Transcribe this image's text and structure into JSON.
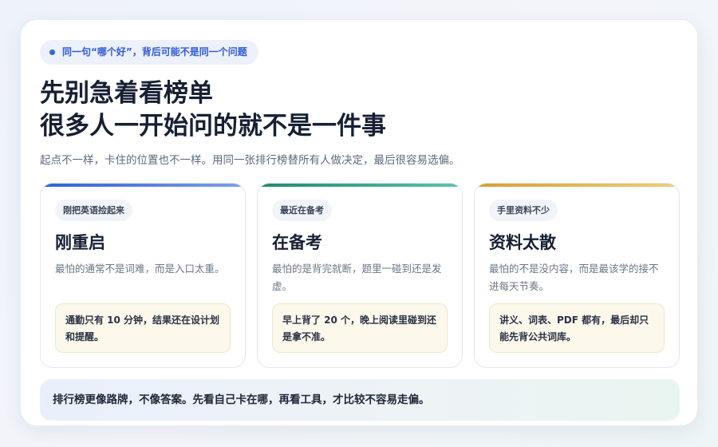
{
  "tag": {
    "text": "同一句“哪个好”，背后可能不是同一个问题",
    "accent": "#3366d6"
  },
  "headline": {
    "line1": "先别急着看榜单",
    "line2": "很多人一开始问的就不是一件事"
  },
  "subtitle": "起点不一样，卡住的位置也不一样。用同一张排行榜替所有人做决定，最后很容易选偏。",
  "panels": [
    {
      "badge": "刚把英语捡起来",
      "title": "刚重启",
      "desc": "最怕的通常不是词难，而是入口太重。",
      "note": "通勤只有 10 分钟，结果还在设计划和提醒。",
      "accent_from": "#2f5fd6",
      "accent_to": "#7fa0ea"
    },
    {
      "badge": "最近在备考",
      "title": "在备考",
      "desc": "最怕的是背完就断，题里一碰到还是发虚。",
      "note": "早上背了 20 个，晚上阅读里碰到还是拿不准。",
      "accent_from": "#1f8a72",
      "accent_to": "#5cc3ae"
    },
    {
      "badge": "手里资料不少",
      "title": "资料太散",
      "desc": "最怕的不是没内容，而是最该学的接不进每天节奏。",
      "note": "讲义、词表、PDF 都有，最后却只能先背公共词库。",
      "accent_from": "#d4a033",
      "accent_to": "#f0cd79"
    }
  ],
  "footer": "排行榜更像路牌，不像答案。先看自己卡在哪，再看工具，才比较不容易走偏。"
}
